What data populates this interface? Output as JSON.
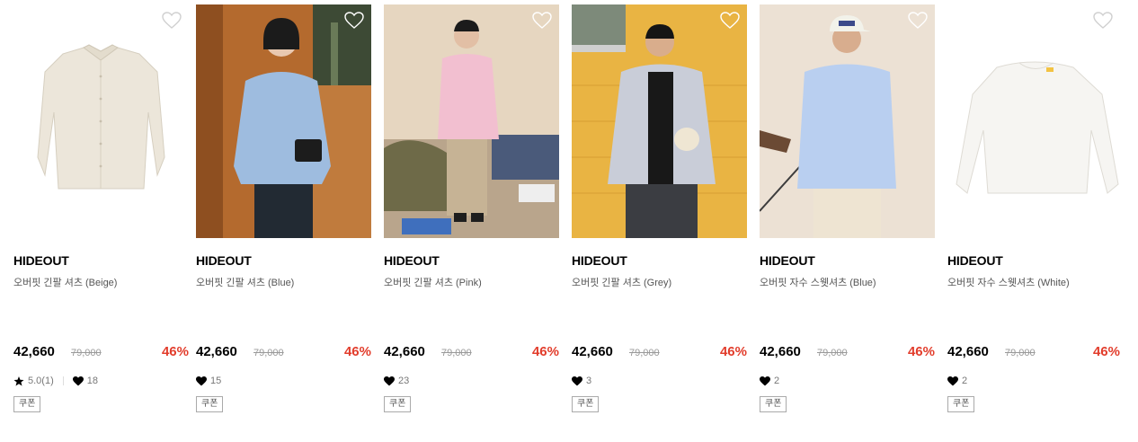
{
  "products": [
    {
      "brand": "HIDEOUT",
      "name": "오버핏 긴팔 셔츠 (Beige)",
      "price": "42,660",
      "original_price": "79,000",
      "discount": "46%",
      "rating": "5.0(1)",
      "likes": "18",
      "coupon": "쿠폰",
      "wished": false
    },
    {
      "brand": "HIDEOUT",
      "name": "오버핏 긴팔 셔츠 (Blue)",
      "price": "42,660",
      "original_price": "79,000",
      "discount": "46%",
      "likes": "15",
      "coupon": "쿠폰",
      "wished": false
    },
    {
      "brand": "HIDEOUT",
      "name": "오버핏 긴팔 셔츠 (Pink)",
      "price": "42,660",
      "original_price": "79,000",
      "discount": "46%",
      "likes": "23",
      "coupon": "쿠폰",
      "wished": false
    },
    {
      "brand": "HIDEOUT",
      "name": "오버핏 긴팔 셔츠 (Grey)",
      "price": "42,660",
      "original_price": "79,000",
      "discount": "46%",
      "likes": "3",
      "coupon": "쿠폰",
      "wished": false
    },
    {
      "brand": "HIDEOUT",
      "name": "오버핏 자수 스웻셔츠 (Blue)",
      "price": "42,660",
      "original_price": "79,000",
      "discount": "46%",
      "likes": "2",
      "coupon": "쿠폰",
      "wished": false
    },
    {
      "brand": "HIDEOUT",
      "name": "오버핏 자수 스웻셔츠 (White)",
      "price": "42,660",
      "original_price": "79,000",
      "discount": "46%",
      "likes": "2",
      "coupon": "쿠폰",
      "wished": false
    }
  ],
  "colors": {
    "discount": "#e23d2c",
    "original_price": "#999999",
    "text": "#000000"
  },
  "icons": {
    "wishlist": "heart-outline-icon",
    "rating": "star-icon",
    "likes": "heart-filled-icon"
  }
}
